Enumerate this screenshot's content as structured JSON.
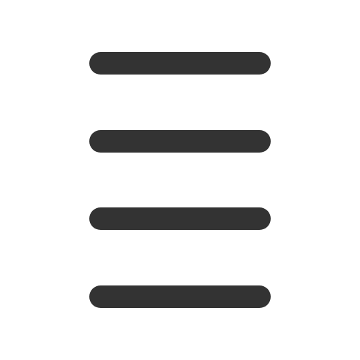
{
  "icon": {
    "name": "menu-icon",
    "color": "#333333",
    "line_count": 4
  }
}
